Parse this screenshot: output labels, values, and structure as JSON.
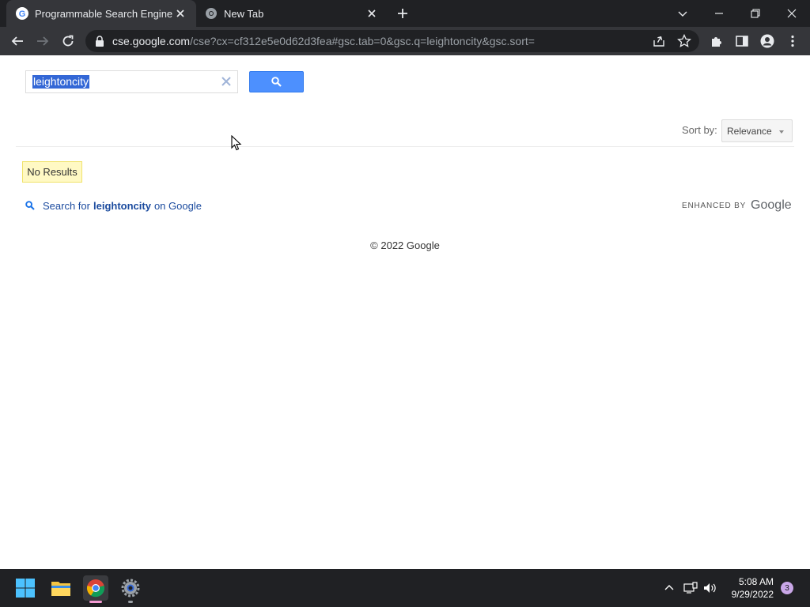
{
  "browser": {
    "tabs": [
      {
        "title": "Programmable Search Engine",
        "active": true
      },
      {
        "title": "New Tab",
        "active": false
      }
    ],
    "address_bar": {
      "host": "cse.google.com",
      "path": "/cse?cx=cf312e5e0d62d3fea#gsc.tab=0&gsc.q=leightoncity&gsc.sort="
    }
  },
  "search": {
    "query": "leightoncity"
  },
  "results": {
    "sort_label": "Sort by:",
    "sort_value": "Relevance",
    "no_results": "No Results",
    "google_search_prefix": "Search for",
    "google_search_term": "leightoncity",
    "google_search_suffix": "on Google",
    "enhanced_by": "ENHANCED BY",
    "brand": "Google",
    "copyright": "© 2022 Google"
  },
  "taskbar": {
    "time": "5:08 AM",
    "date": "9/29/2022",
    "notification_count": "3"
  },
  "colors": {
    "search_button": "#4d90fe",
    "selection_highlight": "#3367d6",
    "no_results_bg": "#fff9c4",
    "link": "#1a4a9e"
  }
}
